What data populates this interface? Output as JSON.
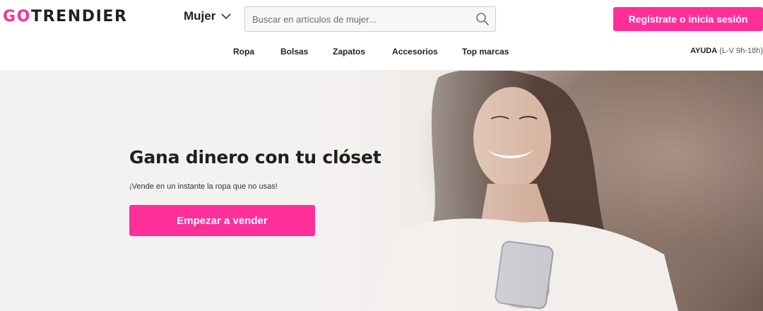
{
  "brand": {
    "logo_prefix": "GO",
    "logo_suffix": "TRENDIER"
  },
  "header": {
    "category": "Mujer",
    "search": {
      "placeholder": "Buscar en artículos de mujer...",
      "value": ""
    },
    "signup_label": "Regístrate o inicia sesión",
    "nav": [
      "Ropa",
      "Bolsas",
      "Zapatos",
      "Accesorios",
      "Top marcas"
    ],
    "help": {
      "label": "AYUDA",
      "hours": "(L-V 9h-18h)"
    }
  },
  "hero": {
    "title": "Gana dinero con tu clóset",
    "subtitle": "¡Vende en un instante la ropa que no usas!",
    "cta_label": "Empezar a vender"
  },
  "colors": {
    "accent": "#ff2f9a",
    "text": "#1f1f1f"
  },
  "icons": {
    "search": "search-icon",
    "dropdown": "chevron-down-icon"
  }
}
